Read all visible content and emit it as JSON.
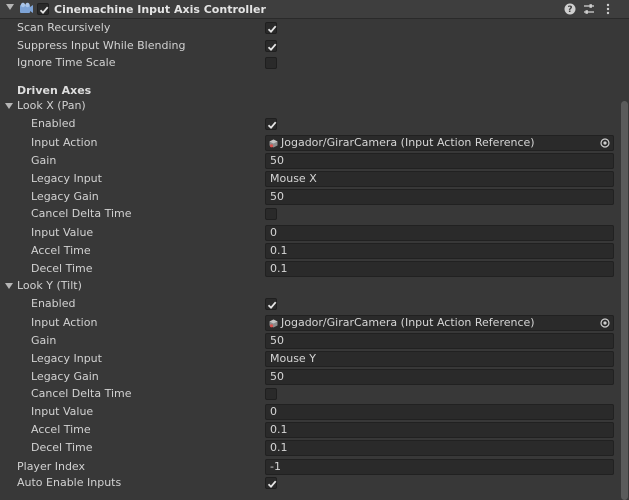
{
  "component": {
    "title": "Cinemachine Input Axis Controller",
    "enabled": true
  },
  "fields": {
    "scan_recursively": {
      "label": "Scan Recursively",
      "checked": true
    },
    "suppress_input": {
      "label": "Suppress Input While Blending",
      "checked": true
    },
    "ignore_time_scale": {
      "label": "Ignore Time Scale",
      "checked": false
    }
  },
  "driven_axes_header": "Driven Axes",
  "axes": [
    {
      "name": "Look X (Pan)",
      "enabled_label": "Enabled",
      "input_action_label": "Input Action",
      "input_action_value": "Jogador/GirarCamera (Input Action Reference)",
      "gain_label": "Gain",
      "gain": "50",
      "legacy_input_label": "Legacy Input",
      "legacy_input": "Mouse X",
      "legacy_gain_label": "Legacy Gain",
      "legacy_gain": "50",
      "cancel_delta_label": "Cancel Delta Time",
      "input_value_label": "Input Value",
      "input_value": "0",
      "accel_label": "Accel Time",
      "accel": "0.1",
      "decel_label": "Decel Time",
      "decel": "0.1"
    },
    {
      "name": "Look Y (Tilt)",
      "enabled_label": "Enabled",
      "input_action_label": "Input Action",
      "input_action_value": "Jogador/GirarCamera (Input Action Reference)",
      "gain_label": "Gain",
      "gain": "50",
      "legacy_input_label": "Legacy Input",
      "legacy_input": "Mouse Y",
      "legacy_gain_label": "Legacy Gain",
      "legacy_gain": "50",
      "cancel_delta_label": "Cancel Delta Time",
      "input_value_label": "Input Value",
      "input_value": "0",
      "accel_label": "Accel Time",
      "accel": "0.1",
      "decel_label": "Decel Time",
      "decel": "0.1"
    }
  ],
  "player_index": {
    "label": "Player Index",
    "value": "-1"
  },
  "auto_enable_inputs": {
    "label": "Auto Enable Inputs",
    "checked": true
  },
  "icons": {
    "header_icon": "cinemachine-component-icon",
    "help": "help-icon",
    "presets": "presets-icon",
    "menu": "kebab-menu-icon",
    "object_field": "input-action-asset-icon",
    "picker": "object-picker-icon"
  }
}
